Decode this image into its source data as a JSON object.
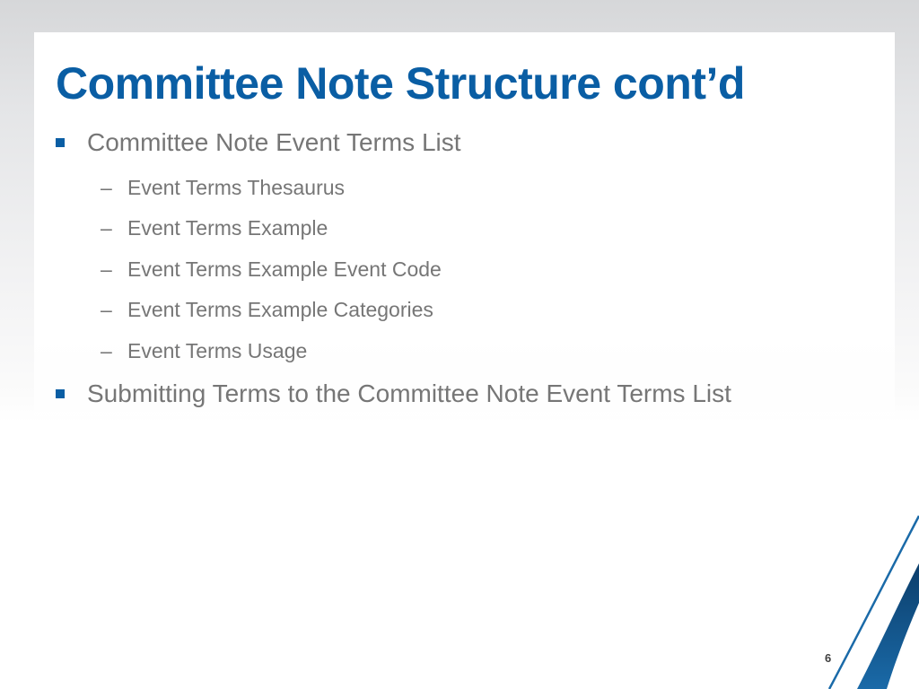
{
  "slide": {
    "title": "Committee Note Structure cont’d",
    "bullets": [
      {
        "text": "Committee Note Event Terms List",
        "sub_items": [
          "Event Terms Thesaurus",
          "Event Terms Example",
          "Event Terms Example Event Code",
          "Event Terms Example Categories",
          "Event Terms Usage"
        ]
      },
      {
        "text": "Submitting Terms to the Committee Note Event Terms List",
        "sub_items": []
      }
    ],
    "sub_bullet_marker": "–",
    "page_number": "6"
  },
  "colors": {
    "accent": "#0a5ea4",
    "body_text": "#767676",
    "swoosh_dark": "#0c3e6b",
    "swoosh_light": "#1a6aa8"
  }
}
